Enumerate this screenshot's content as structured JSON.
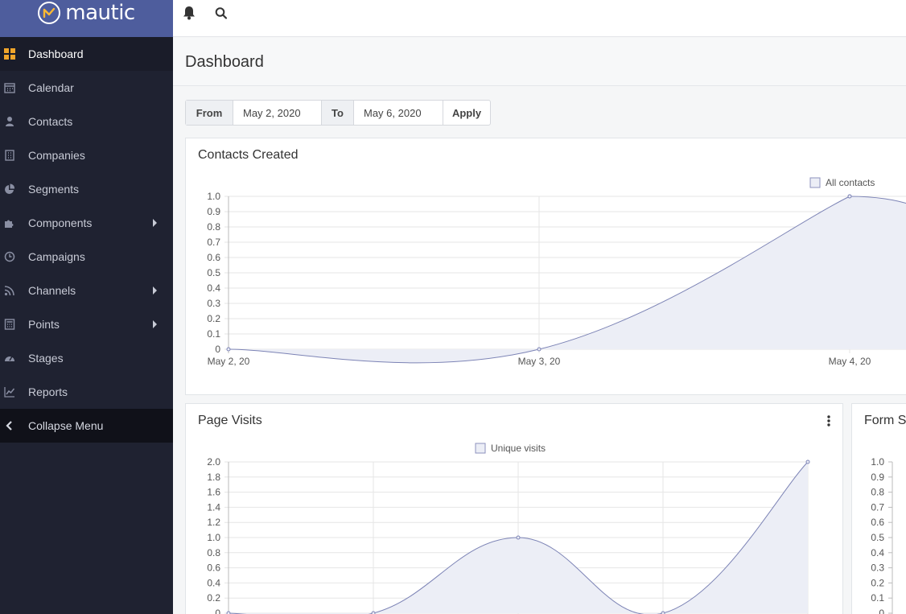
{
  "brand": {
    "name": "mautic"
  },
  "sidebar": {
    "items": [
      {
        "label": "Dashboard",
        "icon": "dashboard-icon",
        "active": true,
        "has_submenu": false
      },
      {
        "label": "Calendar",
        "icon": "calendar-icon",
        "active": false,
        "has_submenu": false
      },
      {
        "label": "Contacts",
        "icon": "user-icon",
        "active": false,
        "has_submenu": false
      },
      {
        "label": "Companies",
        "icon": "building-icon",
        "active": false,
        "has_submenu": false
      },
      {
        "label": "Segments",
        "icon": "pie-chart-icon",
        "active": false,
        "has_submenu": false
      },
      {
        "label": "Components",
        "icon": "puzzle-icon",
        "active": false,
        "has_submenu": true
      },
      {
        "label": "Campaigns",
        "icon": "clock-icon",
        "active": false,
        "has_submenu": false
      },
      {
        "label": "Channels",
        "icon": "rss-icon",
        "active": false,
        "has_submenu": true
      },
      {
        "label": "Points",
        "icon": "calculator-icon",
        "active": false,
        "has_submenu": true
      },
      {
        "label": "Stages",
        "icon": "tachometer-icon",
        "active": false,
        "has_submenu": false
      },
      {
        "label": "Reports",
        "icon": "line-chart-icon",
        "active": false,
        "has_submenu": false
      }
    ],
    "collapse_label": "Collapse Menu"
  },
  "topbar": {
    "icons": [
      "bell-icon",
      "search-icon"
    ]
  },
  "page": {
    "title": "Dashboard"
  },
  "date_filter": {
    "from_label": "From",
    "from_value": "May 2, 2020",
    "to_label": "To",
    "to_value": "May 6, 2020",
    "apply_label": "Apply"
  },
  "colors": {
    "accent": "#4e5d9d",
    "sidebar_bg": "#1f2231",
    "series_line": "#7c83b5",
    "series_fill": "#eceef6"
  },
  "chart_data": [
    {
      "type": "area",
      "title": "Contacts Created",
      "legend": [
        "All contacts"
      ],
      "legend_position": "top-right",
      "x": [
        "May 2, 20",
        "May 3, 20",
        "May 4, 20"
      ],
      "series": [
        {
          "name": "All contacts",
          "values": [
            0,
            0,
            1
          ]
        }
      ],
      "ylim": [
        0,
        1
      ],
      "yticks": [
        "0",
        "0.1",
        "0.2",
        "0.3",
        "0.4",
        "0.5",
        "0.6",
        "0.7",
        "0.8",
        "0.9",
        "1.0"
      ],
      "grid": true
    },
    {
      "type": "area",
      "title": "Page Visits",
      "legend": [
        "Unique visits"
      ],
      "legend_position": "top-center",
      "x": [
        "",
        "",
        "",
        "",
        ""
      ],
      "series": [
        {
          "name": "Unique visits",
          "values": [
            0,
            0,
            1,
            0,
            2
          ]
        }
      ],
      "ylim": [
        0,
        2
      ],
      "yticks": [
        "0",
        "0.2",
        "0.4",
        "0.6",
        "0.8",
        "1.0",
        "1.2",
        "1.4",
        "1.6",
        "1.8",
        "2.0"
      ],
      "grid": true
    },
    {
      "type": "area",
      "title": "Form S",
      "legend": [],
      "x": [],
      "series": [],
      "ylim": [
        0,
        1
      ],
      "yticks": [
        "0",
        "0.1",
        "0.2",
        "0.3",
        "0.4",
        "0.5",
        "0.6",
        "0.7",
        "0.8",
        "0.9",
        "1.0"
      ],
      "grid": false
    }
  ]
}
